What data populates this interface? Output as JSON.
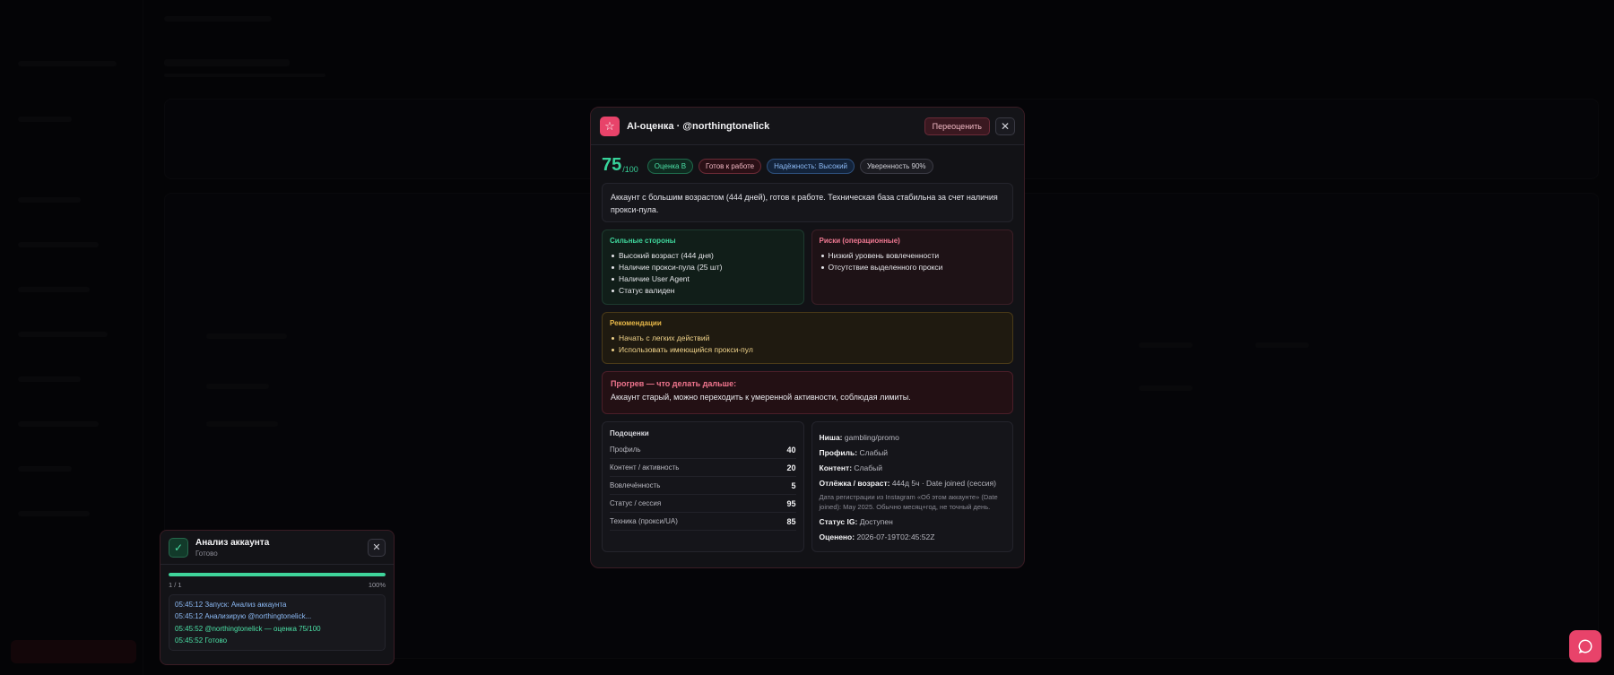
{
  "modal": {
    "title": "AI-оценка · @northingtonelick",
    "rescore_label": "Переоценить",
    "close_icon": "close-icon",
    "score": "75",
    "score_of": "/100",
    "badges": {
      "grade": "Оценка B",
      "ready": "Готов к работе",
      "reliability": "Надёжность: Высокий",
      "confidence": "Уверенность 90%"
    },
    "summary": "Аккаунт с большим возрастом (444 дней), готов к работе. Техническая база стабильна за счет наличия прокси-пула.",
    "strengths": {
      "title": "Сильные стороны",
      "items": [
        "Высокий возраст (444 дня)",
        "Наличие прокси-пула (25 шт)",
        "Наличие User Agent",
        "Статус валиден"
      ]
    },
    "risks": {
      "title": "Риски (операционные)",
      "items": [
        "Низкий уровень вовлеченности",
        "Отсутствие выделенного прокси"
      ]
    },
    "recommendations": {
      "title": "Рекомендации",
      "items": [
        "Начать с легких действий",
        "Использовать имеющийся прокси-пул"
      ]
    },
    "warmup": {
      "title": "Прогрев — что делать дальше:",
      "text": "Аккаунт старый, можно переходить к умеренной активности, соблюдая лимиты."
    },
    "subscores": {
      "title": "Подоценки",
      "rows": [
        {
          "label": "Профиль",
          "value": "40"
        },
        {
          "label": "Контент / активность",
          "value": "20"
        },
        {
          "label": "Вовлечённость",
          "value": "5"
        },
        {
          "label": "Статус / сессия",
          "value": "95"
        },
        {
          "label": "Техника (прокси/UA)",
          "value": "85"
        }
      ]
    },
    "meta": {
      "niche_label": "Ниша:",
      "niche_value": "gambling/promo",
      "profile_label": "Профиль:",
      "profile_value": "Слабый",
      "content_label": "Контент:",
      "content_value": "Слабый",
      "age_label": "Отлёжка / возраст:",
      "age_value": "444д 5ч · Date joined (сессия)",
      "age_note": "Дата регистрации из Instagram «Об этом аккаунте» (Date joined): May 2025. Обычно месяц+год, не точный день.",
      "status_label": "Статус IG:",
      "status_value": "Доступен",
      "rated_label": "Оценено:",
      "rated_value": "2026-07-19T02:45:52Z"
    }
  },
  "panel": {
    "title": "Анализ аккаунта",
    "subtitle": "Готово",
    "progress_count": "1 / 1",
    "progress_percent": "100%",
    "progress_fraction": 1.0,
    "log": [
      "05:45:12 Запуск: Анализ аккаунта",
      "05:45:12 Анализирую @northingtonelick...",
      "05:45:52 @northingtonelick — оценка 75/100",
      "05:45:52 Готово"
    ]
  },
  "colors": {
    "accent": "#e8436a",
    "success": "#3fd59b",
    "warning": "#e9b949"
  }
}
